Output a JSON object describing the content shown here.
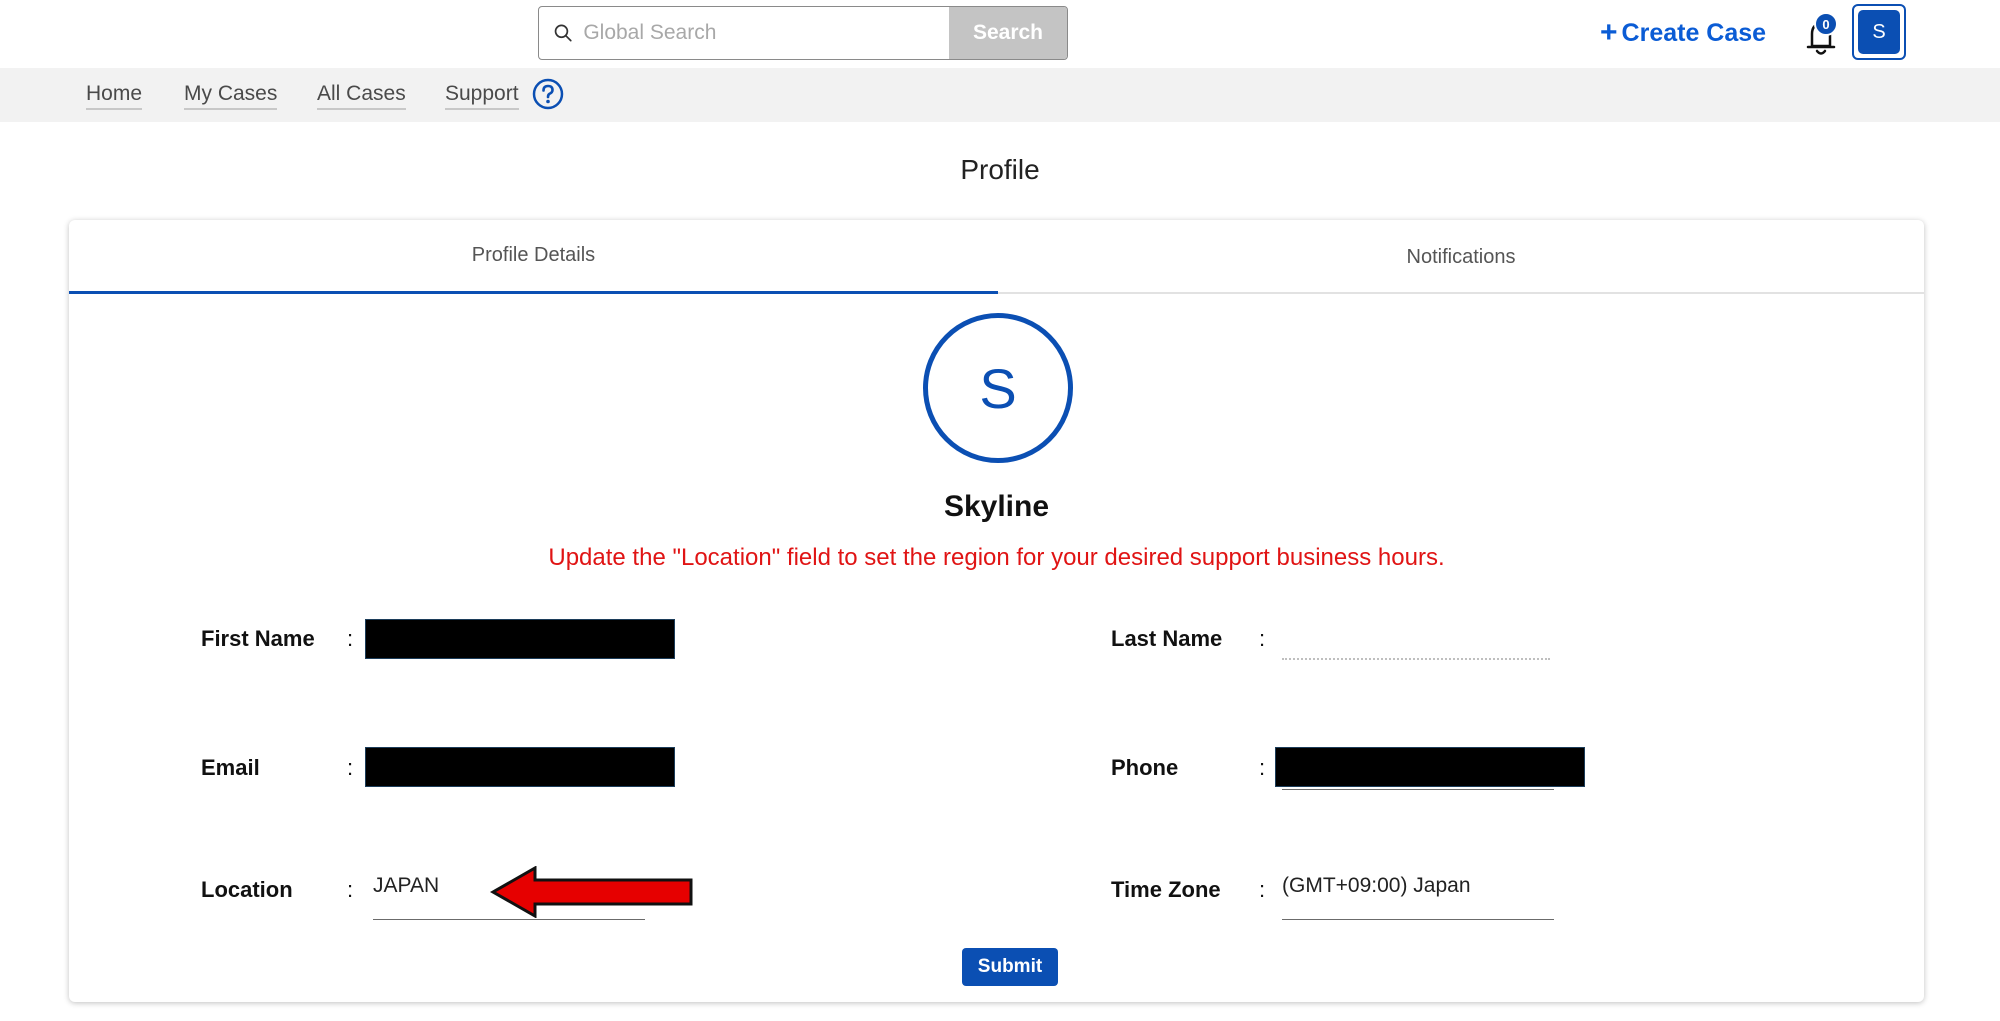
{
  "header": {
    "search": {
      "placeholder": "Global Search",
      "button_label": "Search"
    },
    "create_case_label": "Create Case",
    "notification_count": "0",
    "avatar_initial": "S"
  },
  "nav": {
    "items": [
      {
        "label": "Home"
      },
      {
        "label": "My Cases"
      },
      {
        "label": "All Cases"
      },
      {
        "label": "Support"
      }
    ]
  },
  "page": {
    "title": "Profile"
  },
  "tabs": [
    {
      "label": "Profile Details",
      "active": true
    },
    {
      "label": "Notifications",
      "active": false
    }
  ],
  "profile": {
    "initial": "S",
    "name": "Skyline",
    "notice": "Update the \"Location\" field to set the region for your desired support business hours."
  },
  "fields": {
    "first_name": {
      "label": "First Name",
      "value": ""
    },
    "last_name": {
      "label": "Last Name",
      "value": ""
    },
    "email": {
      "label": "Email",
      "value": ""
    },
    "phone": {
      "label": "Phone",
      "value": ""
    },
    "location": {
      "label": "Location",
      "value": "JAPAN"
    },
    "time_zone": {
      "label": "Time Zone",
      "value": "(GMT+09:00) Japan"
    }
  },
  "submit_label": "Submit",
  "colors": {
    "accent": "#0b4fb3",
    "link": "#0b5cd5",
    "notice": "#e01414",
    "annotation_arrow": "#e60000"
  },
  "icons": [
    "search-icon",
    "plus-icon",
    "bell-icon",
    "help-icon",
    "arrow-left-icon"
  ]
}
